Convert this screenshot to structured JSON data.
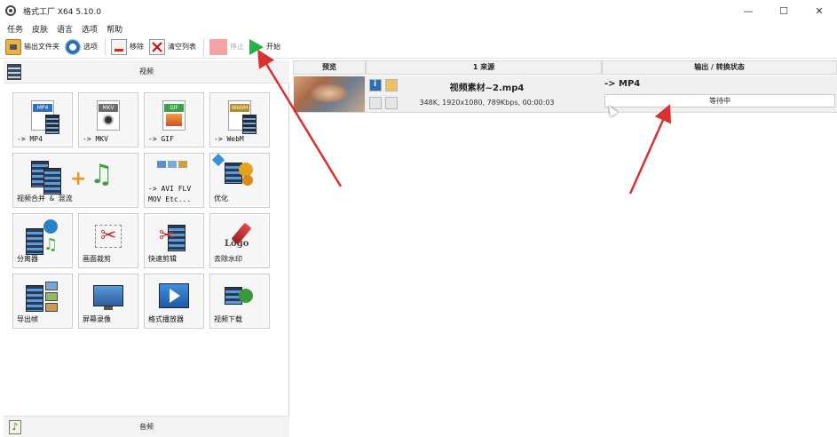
{
  "window": {
    "title": "格式工厂 X64 5.10.0",
    "controls": {
      "minimize": "—",
      "maximize": "☐",
      "close": "✕"
    }
  },
  "menu": [
    "任务",
    "皮肤",
    "语言",
    "选项",
    "帮助"
  ],
  "toolbar": {
    "output_folder": "输出文件夹",
    "options": "选项",
    "remove": "移除",
    "clear_list": "清空列表",
    "stop": "停止",
    "start": "开始"
  },
  "left_panel": {
    "video_category": "视频",
    "audio_category": "音频",
    "tiles": [
      {
        "label": "-> MP4",
        "badge": "MP4",
        "badge_color": "#2f6fc0"
      },
      {
        "label": "-> MKV",
        "badge": "MKV",
        "badge_color": "#6b6b6b"
      },
      {
        "label": "-> GIF",
        "badge": "GIF",
        "badge_color": "#3aa14a"
      },
      {
        "label": "-> WebM",
        "badge": "WebM",
        "badge_color": "#b58a2a"
      },
      {
        "label": "视频合并 & 混流"
      },
      {
        "label_line1": "-> AVI FLV",
        "label_line2": "MOV Etc..."
      },
      {
        "label": "优化"
      },
      {
        "label": "分离器"
      },
      {
        "label": "画面裁剪"
      },
      {
        "label": "快速剪辑"
      },
      {
        "label": "去除水印",
        "logo_text": "Logo"
      },
      {
        "label": "导出帧"
      },
      {
        "label": "屏幕录像"
      },
      {
        "label": "格式播放器"
      },
      {
        "label": "视频下载"
      }
    ]
  },
  "task_list": {
    "columns": {
      "preview": "预览",
      "source": "1 来源",
      "output": "输出 / 转换状态"
    },
    "rows": [
      {
        "file_name": "视频素材~2.mp4",
        "meta": "348K, 1920x1080, 789Kbps, 00:00:03",
        "output_format": "-> MP4",
        "status": "等待中"
      }
    ]
  },
  "colors": {
    "annotation_arrow": "#d93030",
    "start_green": "#22b14c"
  }
}
